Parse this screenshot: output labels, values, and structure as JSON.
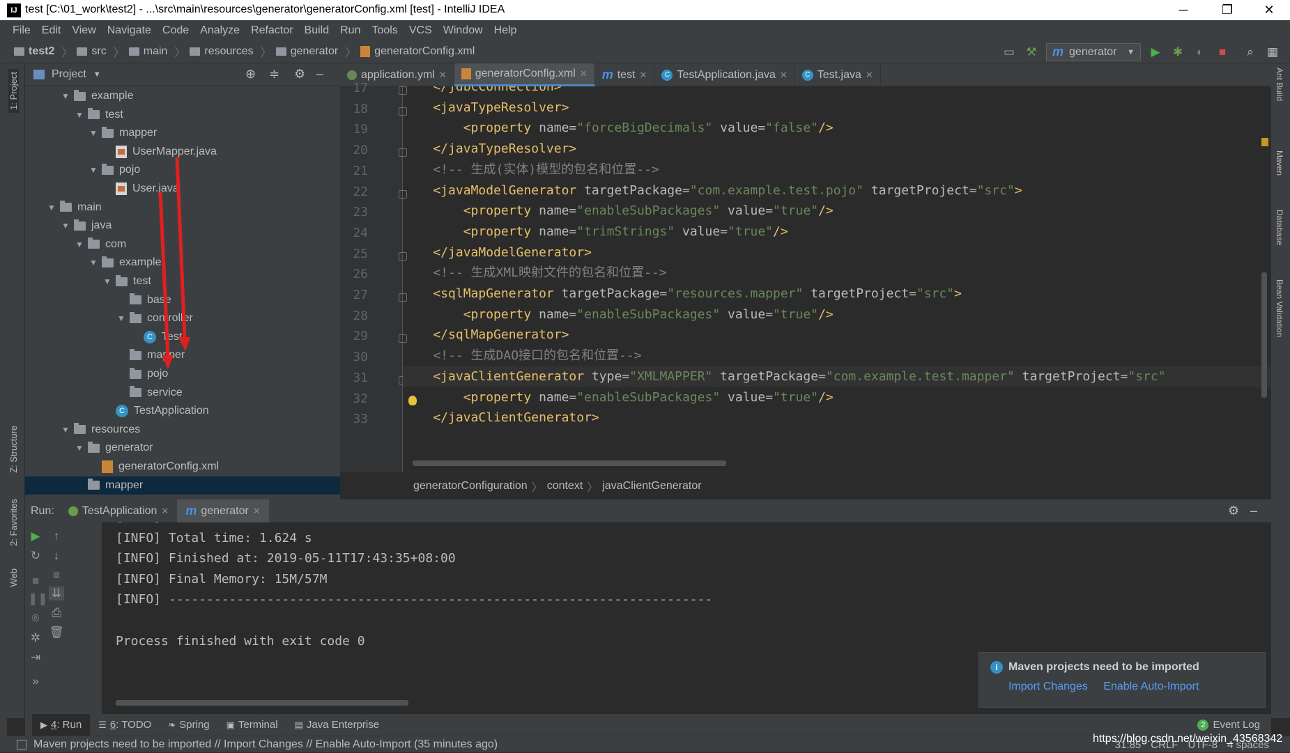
{
  "window": {
    "title": "test [C:\\01_work\\test2] - ...\\src\\main\\resources\\generator\\generatorConfig.xml [test] - IntelliJ IDEA",
    "minimize": "─",
    "restore": "❐",
    "close": "✕",
    "app_icon": "IJ"
  },
  "menu": [
    "File",
    "Edit",
    "View",
    "Navigate",
    "Code",
    "Analyze",
    "Refactor",
    "Build",
    "Run",
    "Tools",
    "VCS",
    "Window",
    "Help"
  ],
  "breadcrumb": [
    "test2",
    "src",
    "main",
    "resources",
    "generator",
    "generatorConfig.xml"
  ],
  "run_config": {
    "label": "generator",
    "icon": "m"
  },
  "project_panel": {
    "title": "Project"
  },
  "tree": [
    {
      "label": "example",
      "depth": 3,
      "kind": "folder",
      "arrow": "▼"
    },
    {
      "label": "test",
      "depth": 4,
      "kind": "folder",
      "arrow": "▼"
    },
    {
      "label": "mapper",
      "depth": 5,
      "kind": "folder",
      "arrow": "▼"
    },
    {
      "label": "UserMapper.java",
      "depth": 6,
      "kind": "java",
      "arrow": ""
    },
    {
      "label": "pojo",
      "depth": 5,
      "kind": "folder",
      "arrow": "▼"
    },
    {
      "label": "User.java",
      "depth": 6,
      "kind": "java",
      "arrow": ""
    },
    {
      "label": "main",
      "depth": 2,
      "kind": "folder",
      "arrow": "▼"
    },
    {
      "label": "java",
      "depth": 3,
      "kind": "folder",
      "arrow": "▼"
    },
    {
      "label": "com",
      "depth": 4,
      "kind": "folder",
      "arrow": "▼"
    },
    {
      "label": "example",
      "depth": 5,
      "kind": "folder",
      "arrow": "▼"
    },
    {
      "label": "test",
      "depth": 6,
      "kind": "folder",
      "arrow": "▼"
    },
    {
      "label": "base",
      "depth": 7,
      "kind": "folder",
      "arrow": ""
    },
    {
      "label": "controller",
      "depth": 7,
      "kind": "folder",
      "arrow": "▼"
    },
    {
      "label": "Test",
      "depth": 8,
      "kind": "class",
      "arrow": ""
    },
    {
      "label": "mapper",
      "depth": 7,
      "kind": "folder",
      "arrow": ""
    },
    {
      "label": "pojo",
      "depth": 7,
      "kind": "folder",
      "arrow": ""
    },
    {
      "label": "service",
      "depth": 7,
      "kind": "folder",
      "arrow": ""
    },
    {
      "label": "TestApplication",
      "depth": 6,
      "kind": "class",
      "arrow": ""
    },
    {
      "label": "resources",
      "depth": 3,
      "kind": "folder",
      "arrow": "▼"
    },
    {
      "label": "generator",
      "depth": 4,
      "kind": "folder",
      "arrow": "▼"
    },
    {
      "label": "generatorConfig.xml",
      "depth": 5,
      "kind": "xml",
      "arrow": ""
    },
    {
      "label": "mapper",
      "depth": 4,
      "kind": "folder",
      "arrow": "",
      "selected": true
    }
  ],
  "tabs": [
    {
      "label": "application.yml",
      "icon": "yml",
      "active": false
    },
    {
      "label": "generatorConfig.xml",
      "icon": "xml",
      "active": true
    },
    {
      "label": "test",
      "icon": "m",
      "active": false
    },
    {
      "label": "TestApplication.java",
      "icon": "java",
      "active": false
    },
    {
      "label": "Test.java",
      "icon": "class",
      "active": false
    }
  ],
  "editor": {
    "line_numbers": [
      "17",
      "18",
      "19",
      "20",
      "21",
      "22",
      "23",
      "24",
      "25",
      "26",
      "27",
      "28",
      "29",
      "30",
      "31",
      "32",
      "33"
    ],
    "lines": [
      [
        [
          "t",
          "    </jdbcConnection>"
        ]
      ],
      [
        [
          "t",
          "    <javaTypeResolver>"
        ]
      ],
      [
        [
          "t",
          "        <property "
        ],
        [
          "a",
          "name="
        ],
        [
          "v",
          "\"forceBigDecimals\" "
        ],
        [
          "a",
          "value="
        ],
        [
          "v",
          "\"false\""
        ],
        [
          "t",
          "/>"
        ]
      ],
      [
        [
          "t",
          "    </javaTypeResolver>"
        ]
      ],
      [
        [
          "c",
          "    <!-- 生成(实体)模型的包名和位置-->"
        ]
      ],
      [
        [
          "t",
          "    <javaModelGenerator "
        ],
        [
          "a",
          "targetPackage="
        ],
        [
          "v",
          "\"com.example.test.pojo\" "
        ],
        [
          "a",
          "targetProject="
        ],
        [
          "v",
          "\"src\""
        ],
        [
          "t",
          ">"
        ]
      ],
      [
        [
          "t",
          "        <property "
        ],
        [
          "a",
          "name="
        ],
        [
          "v",
          "\"enableSubPackages\" "
        ],
        [
          "a",
          "value="
        ],
        [
          "v",
          "\"true\""
        ],
        [
          "t",
          "/>"
        ]
      ],
      [
        [
          "t",
          "        <property "
        ],
        [
          "a",
          "name="
        ],
        [
          "v",
          "\"trimStrings\" "
        ],
        [
          "a",
          "value="
        ],
        [
          "v",
          "\"true\""
        ],
        [
          "t",
          "/>"
        ]
      ],
      [
        [
          "t",
          "    </javaModelGenerator>"
        ]
      ],
      [
        [
          "c",
          "    <!-- 生成XML映射文件的包名和位置-->"
        ]
      ],
      [
        [
          "t",
          "    <sqlMapGenerator "
        ],
        [
          "a",
          "targetPackage="
        ],
        [
          "v",
          "\"resources.mapper\" "
        ],
        [
          "a",
          "targetProject="
        ],
        [
          "v",
          "\"src\""
        ],
        [
          "t",
          ">"
        ]
      ],
      [
        [
          "t",
          "        <property "
        ],
        [
          "a",
          "name="
        ],
        [
          "v",
          "\"enableSubPackages\" "
        ],
        [
          "a",
          "value="
        ],
        [
          "v",
          "\"true\""
        ],
        [
          "t",
          "/>"
        ]
      ],
      [
        [
          "t",
          "    </sqlMapGenerator>"
        ]
      ],
      [
        [
          "c",
          "    <!-- 生成DAO接口的包名和位置-->"
        ]
      ],
      [
        [
          "t",
          "    <javaClientGenerator "
        ],
        [
          "a",
          "type="
        ],
        [
          "v",
          "\"XMLMAPPER\" "
        ],
        [
          "a",
          "targetPackage="
        ],
        [
          "v",
          "\"com.example.test.mapper\" "
        ],
        [
          "a",
          "targetProject="
        ],
        [
          "v",
          "\"src\""
        ]
      ],
      [
        [
          "t",
          "        <property "
        ],
        [
          "a",
          "name="
        ],
        [
          "v",
          "\"enableSubPackages\" "
        ],
        [
          "a",
          "value="
        ],
        [
          "v",
          "\"true\""
        ],
        [
          "t",
          "/>"
        ]
      ],
      [
        [
          "t",
          "    </javaClientGenerator>"
        ]
      ]
    ],
    "breadcrumb": [
      "generatorConfiguration",
      "context",
      "javaClientGenerator"
    ]
  },
  "run": {
    "label": "Run:",
    "tabs": [
      {
        "label": "TestApplication",
        "active": false
      },
      {
        "label": "generator",
        "active": true
      }
    ],
    "output": [
      "[INFO]",
      "[INFO] Total time: 1.624 s",
      "[INFO] Finished at: 2019-05-11T17:43:35+08:00",
      "[INFO] Final Memory: 15M/57M",
      "[INFO] ------------------------------------------------------------------------",
      "",
      "Process finished with exit code 0"
    ]
  },
  "notification": {
    "title": "Maven projects need to be imported",
    "actions": [
      "Import Changes",
      "Enable Auto-Import"
    ]
  },
  "bottom_tabs": [
    {
      "num": "4",
      "label": ": Run",
      "active": true
    },
    {
      "num": "6",
      "label": ": TODO",
      "active": false
    },
    {
      "num": "",
      "label": "Spring",
      "active": false
    },
    {
      "num": "",
      "label": "Terminal",
      "active": false
    },
    {
      "num": "",
      "label": "Java Enterprise",
      "active": false
    }
  ],
  "event_log": {
    "count": "2",
    "label": "Event Log"
  },
  "status": {
    "message": "Maven projects need to be imported // Import Changes // Enable Auto-Import (35 minutes ago)",
    "position": "31:85",
    "line_sep": "CRLF",
    "encoding": "UTF-8",
    "indent": "4 spaces"
  },
  "left_tool_tabs": [
    "1: Project",
    "Z: Structure",
    "2: Favorites",
    "Web"
  ],
  "right_tool_tabs": [
    "Ant Build",
    "Maven",
    "Database",
    "Bean Validation"
  ],
  "watermark": "https://blog.csdn.net/weixin_43568342",
  "colors": {
    "tag": "#e8bf6a",
    "attr": "#bababa",
    "value": "#6a8759",
    "comment": "#808080",
    "arrow": "#e02020",
    "link": "#589df6"
  },
  "icons": [
    "folder-icon",
    "java-file-icon",
    "class-icon",
    "xml-file-icon",
    "run-icon",
    "debug-icon",
    "stop-icon",
    "search-icon",
    "gear-icon",
    "lightbulb-icon",
    "info-icon"
  ]
}
